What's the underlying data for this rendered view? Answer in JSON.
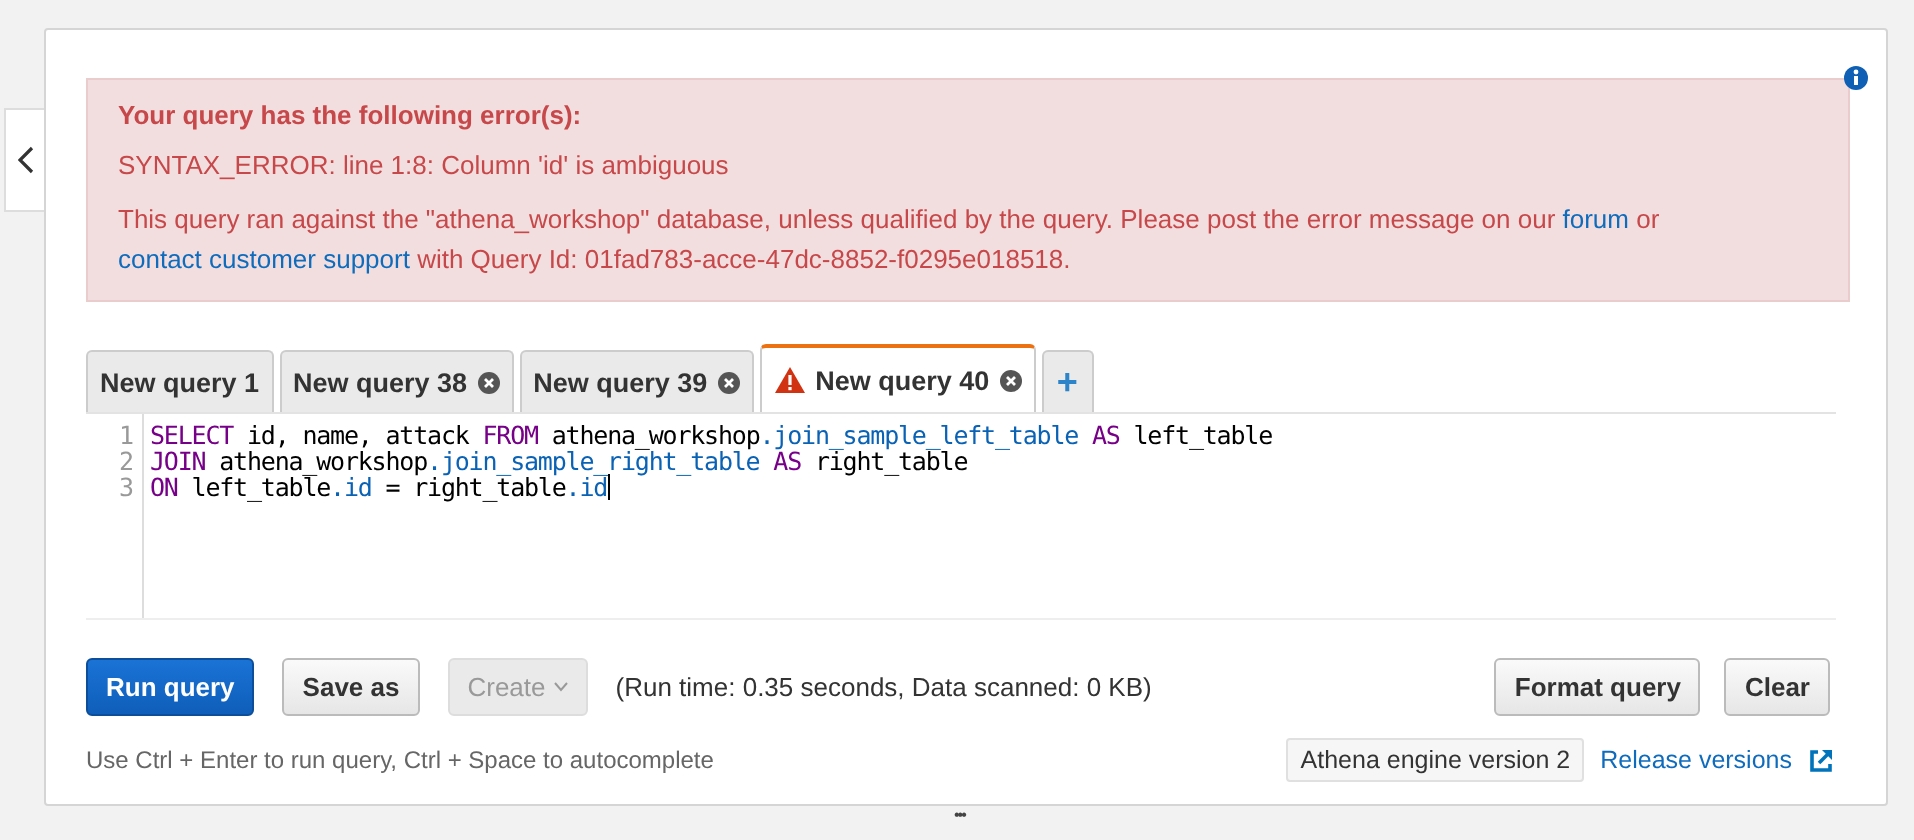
{
  "error": {
    "title": "Your query has the following error(s):",
    "message": "SYNTAX_ERROR: line 1:8: Column 'id' is ambiguous",
    "details": [
      {
        "kind": "text",
        "text": "This query ran against the \"athena_workshop\" database, unless qualified by the query. Please post the error message on our "
      },
      {
        "kind": "link",
        "text": "forum"
      },
      {
        "kind": "text",
        "text": " or "
      },
      {
        "kind": "link",
        "text": "contact customer support"
      },
      {
        "kind": "text",
        "text": " with Query Id: 01fad783-acce-47dc-8852-f0295e018518."
      }
    ]
  },
  "tabs": [
    {
      "label": "New query 1",
      "selected": false,
      "closable": false,
      "warning": false
    },
    {
      "label": "New query 38",
      "selected": false,
      "closable": true,
      "warning": false
    },
    {
      "label": "New query 39",
      "selected": false,
      "closable": true,
      "warning": false
    },
    {
      "label": "New query 40",
      "selected": true,
      "closable": true,
      "warning": true
    }
  ],
  "add_tab": "+",
  "editor": {
    "lines": [
      {
        "number": "1",
        "tokens": [
          {
            "kind": "keyword",
            "text": "SELECT"
          },
          {
            "kind": "plain",
            "text": " id, name, attack "
          },
          {
            "kind": "keyword",
            "text": "FROM"
          },
          {
            "kind": "plain",
            "text": " athena_workshop"
          },
          {
            "kind": "member",
            "text": ".join_sample_left_table"
          },
          {
            "kind": "keyword",
            "text": " AS"
          },
          {
            "kind": "plain",
            "text": " left_table"
          }
        ]
      },
      {
        "number": "2",
        "tokens": [
          {
            "kind": "keyword",
            "text": "JOIN"
          },
          {
            "kind": "plain",
            "text": " athena_workshop"
          },
          {
            "kind": "member",
            "text": ".join_sample_right_table"
          },
          {
            "kind": "keyword",
            "text": " AS"
          },
          {
            "kind": "plain",
            "text": " right_table"
          }
        ]
      },
      {
        "number": "3",
        "tokens": [
          {
            "kind": "keyword",
            "text": "ON"
          },
          {
            "kind": "plain",
            "text": " left_table"
          },
          {
            "kind": "member",
            "text": ".id"
          },
          {
            "kind": "plain",
            "text": " = right_table"
          },
          {
            "kind": "member",
            "text": ".id"
          }
        ]
      }
    ]
  },
  "actions": [
    {
      "label": "Run query",
      "kind": "primary",
      "disabled": false
    },
    {
      "label": "Save as",
      "kind": "default",
      "disabled": false
    },
    {
      "label": "Create",
      "kind": "dropdown",
      "disabled": true
    }
  ],
  "run_stats": "(Run time: 0.35 seconds, Data scanned: 0 KB)",
  "right_actions": [
    {
      "label": "Format query"
    },
    {
      "label": "Clear"
    }
  ],
  "hint": "Use Ctrl + Enter to run query, Ctrl + Space to autocomplete",
  "engine_version": "Athena engine version 2",
  "release_link": "Release versions",
  "resize_handle": "•••"
}
